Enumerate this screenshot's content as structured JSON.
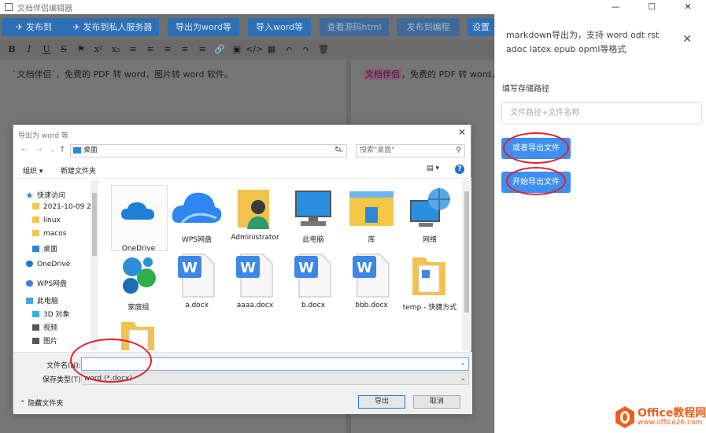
{
  "app": {
    "title": "文档伴侣编辑器",
    "window_controls": [
      "—",
      "☐",
      "✕"
    ]
  },
  "toolbar": {
    "buttons": [
      {
        "label": "✈ 发布到"
      },
      {
        "label": "✈ 发布到私人服务器"
      },
      {
        "label": "导出为word等"
      },
      {
        "label": "导入word等"
      },
      {
        "label": "查看源码html"
      },
      {
        "label": "发布到编程"
      },
      {
        "label": "设置"
      }
    ],
    "format_icons": [
      "B",
      "I",
      "U",
      "S",
      "⚑",
      "x²",
      "x₂",
      "≡",
      "≡",
      "≡",
      "≡",
      "≡",
      "🔗",
      "▣",
      "</>",
      "▦",
      "↶",
      "↷",
      "🗑"
    ]
  },
  "editor": {
    "left_text": "`文档伴侣`，免费的 PDF 转 word，图片转 word 软件。",
    "right_highlight": "文档伴侣",
    "right_text": "，免费的 PDF 转 word，"
  },
  "right_panel": {
    "description": "markdown导出为，支持 word odt rst adoc latex epub opml等格式",
    "close": "✕",
    "path_label": "填写存储路径",
    "path_placeholder": "文件路径+文件名称",
    "export_file_button": "或者导出文件",
    "start_export_button": "开始导出文件"
  },
  "dialog": {
    "title": "导出为 word 等",
    "close": "✕",
    "address": "桌面",
    "search_placeholder": "搜索\"桌面\"",
    "organize": "组织 ▾",
    "new_folder": "新建文件夹",
    "nav_items": [
      {
        "label": "快速访问",
        "icon": "star-icon",
        "color": "#2a7ad8"
      },
      {
        "label": "2021-10-09 21.",
        "icon": "folder-icon",
        "color": "#f5c748"
      },
      {
        "label": "linux",
        "icon": "folder-icon",
        "color": "#f5c748"
      },
      {
        "label": "macos",
        "icon": "folder-icon",
        "color": "#f5c748"
      },
      {
        "label": "桌面",
        "icon": "desktop-icon",
        "color": "#2a88d8"
      },
      {
        "label": "OneDrive",
        "icon": "cloud-icon",
        "color": "#1b79d3"
      },
      {
        "label": "WPS网盘",
        "icon": "cloud-icon",
        "color": "#3b7fe0"
      },
      {
        "label": "此电脑",
        "icon": "computer-icon",
        "color": "#4aa0e0"
      },
      {
        "label": "3D 对象",
        "icon": "cube-icon",
        "color": "#3ab0e0"
      },
      {
        "label": "视频",
        "icon": "video-icon",
        "color": "#555555"
      },
      {
        "label": "图片",
        "icon": "picture-icon",
        "color": "#555555"
      }
    ],
    "files": [
      {
        "name": "OneDrive",
        "icon": "onedrive-icon"
      },
      {
        "name": "WPS网盘",
        "icon": "wps-cloud-icon"
      },
      {
        "name": "Administrator",
        "icon": "user-folder-icon"
      },
      {
        "name": "此电脑",
        "icon": "computer-icon"
      },
      {
        "name": "库",
        "icon": "library-icon"
      },
      {
        "name": "网络",
        "icon": "network-icon"
      },
      {
        "name": "家庭组",
        "icon": "homegroup-icon"
      },
      {
        "name": "a.docx",
        "icon": "wps-doc-icon"
      },
      {
        "name": "aaaa.docx",
        "icon": "wps-doc-icon"
      },
      {
        "name": "b.docx",
        "icon": "wps-doc-icon"
      },
      {
        "name": "bbb.docx",
        "icon": "wps-doc-icon"
      },
      {
        "name": "temp - 快捷方式",
        "icon": "shortcut-folder-icon"
      },
      {
        "name": "",
        "icon": "folder-icon"
      }
    ],
    "filename_label": "文件名(N):",
    "filename_value": "",
    "filetype_label": "保存类型(T):",
    "filetype_value": "word (*.docx)",
    "hide_folders": "⌃ 隐藏文件夹",
    "save_button": "导出",
    "cancel_button": "取消"
  },
  "watermark": {
    "line1": "Office教程网",
    "line2": "www.office26.com"
  },
  "colors": {
    "primary": "#3f8ff0",
    "annotation_ring": "#e0202a",
    "watermark": "#e8621d"
  }
}
